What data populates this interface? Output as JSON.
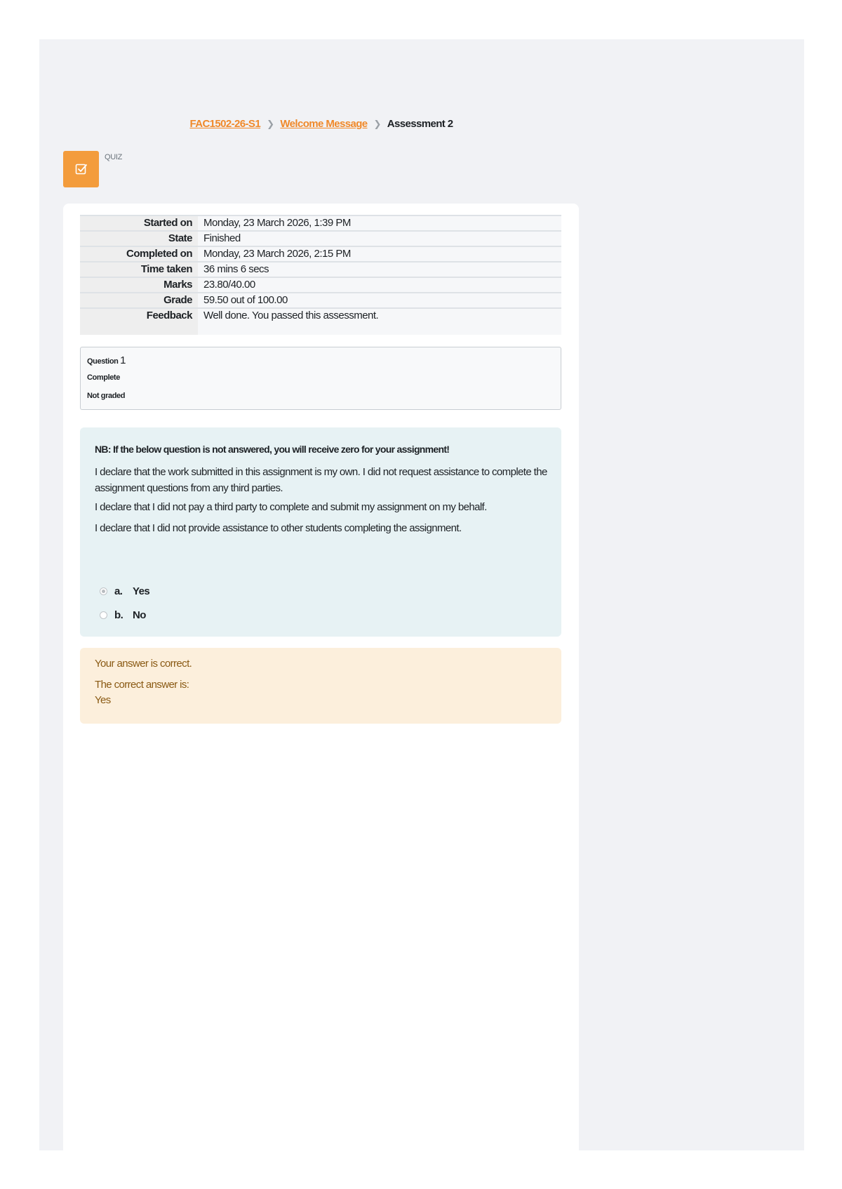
{
  "breadcrumb": {
    "items": [
      "FAC1502-26-S1",
      "Welcome Message"
    ],
    "current": "Assessment 2"
  },
  "header": {
    "module_type": "QUIZ",
    "icon": "quiz-checkbox-icon"
  },
  "summary": [
    {
      "label": "Started on",
      "value": "Monday, 23 March 2026, 1:39 PM"
    },
    {
      "label": "State",
      "value": "Finished"
    },
    {
      "label": "Completed on",
      "value": "Monday, 23 March 2026, 2:15 PM"
    },
    {
      "label": "Time taken",
      "value": "36 mins 6 secs"
    },
    {
      "label": "Marks",
      "value": "23.80/40.00"
    },
    {
      "label": "Grade",
      "value": "59.50 out of 100.00"
    },
    {
      "label": "Feedback",
      "value": "Well done. You passed this assessment."
    }
  ],
  "question": {
    "label": "Question",
    "number": "1",
    "state": "Complete",
    "grade": "Not graded",
    "notice": "NB: If the below question is not answered, you will receive zero for your assignment!",
    "paragraphs": [
      "I declare that the work submitted in this assignment is my own. I did not request assistance to complete the assignment questions from any third parties.",
      "I declare that I did not pay a third party to complete and submit my assignment on my behalf.",
      "I declare that I did not provide assistance to other students completing the assignment."
    ],
    "answers": [
      {
        "letter": "a.",
        "text": "Yes",
        "selected": true
      },
      {
        "letter": "b.",
        "text": "No",
        "selected": false
      }
    ]
  },
  "outcome": {
    "result": "Your answer is correct.",
    "right_answer_label": "The correct answer is:",
    "right_answer": "Yes"
  },
  "colors": {
    "accent": "#f0892a",
    "page_bg": "#f1f2f5",
    "formulation_bg": "#e7f2f4",
    "outcome_bg": "#fcefdc"
  }
}
